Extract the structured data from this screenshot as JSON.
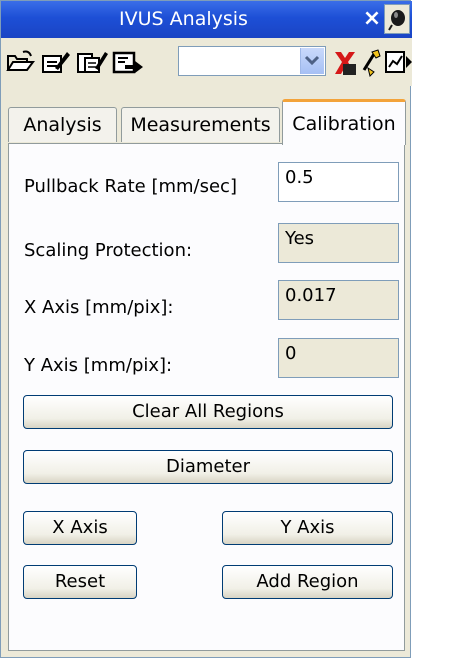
{
  "window": {
    "title": "IVUS Analysis",
    "close_glyph": "×"
  },
  "toolbar": {
    "icons": [
      "open-folder-icon",
      "edit-data-icon",
      "edit-all-icon",
      "export-icon",
      "delete-red-icon",
      "wand-icon",
      "chart-icon",
      "more-arrow-icon"
    ],
    "combo_value": ""
  },
  "tabs": [
    {
      "label": "Analysis",
      "active": false
    },
    {
      "label": "Measurements",
      "active": false
    },
    {
      "label": "Calibration",
      "active": true
    }
  ],
  "calibration": {
    "pullback_label": "Pullback Rate [mm/sec]",
    "pullback_value": "0.5",
    "scaling_label": "Scaling Protection:",
    "scaling_value": "Yes",
    "xaxis_label": "X Axis [mm/pix]:",
    "xaxis_value": "0.017",
    "yaxis_label": "Y Axis [mm/pix]:",
    "yaxis_value": "0"
  },
  "buttons": {
    "clear_all": "Clear All Regions",
    "diameter": "Diameter",
    "x_axis": "X Axis",
    "y_axis": "Y Axis",
    "reset": "Reset",
    "add_region": "Add Region"
  },
  "colors": {
    "title_bar": "#1d4fd6",
    "panel": "#ece9d8",
    "active_tab_accent": "#f3a33a"
  }
}
